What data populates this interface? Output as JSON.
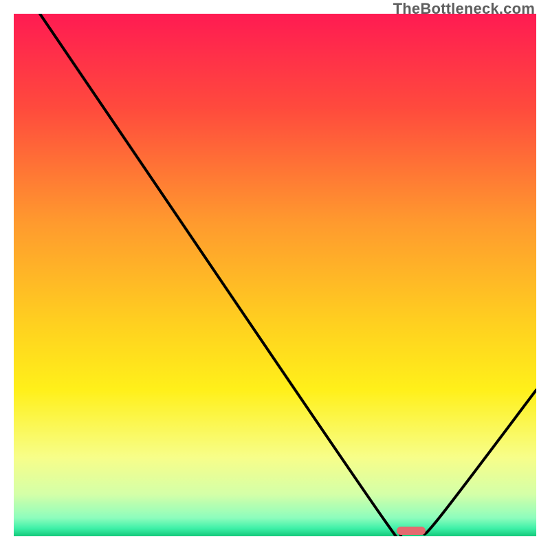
{
  "watermark": "TheBottleneck.com",
  "chart_data": {
    "type": "line",
    "title": "",
    "xlabel": "",
    "ylabel": "",
    "xlim": [
      0,
      100
    ],
    "ylim": [
      0,
      100
    ],
    "grid": false,
    "background_gradient_stops": [
      {
        "offset": 0.0,
        "color": "#ff1b52"
      },
      {
        "offset": 0.18,
        "color": "#ff4a3d"
      },
      {
        "offset": 0.4,
        "color": "#ff9a2e"
      },
      {
        "offset": 0.6,
        "color": "#ffd21f"
      },
      {
        "offset": 0.72,
        "color": "#fff01a"
      },
      {
        "offset": 0.85,
        "color": "#f7fe8a"
      },
      {
        "offset": 0.92,
        "color": "#d4ffa8"
      },
      {
        "offset": 0.965,
        "color": "#8dfdbd"
      },
      {
        "offset": 0.985,
        "color": "#3ef0a8"
      },
      {
        "offset": 1.0,
        "color": "#13c97a"
      }
    ],
    "series": [
      {
        "name": "bottleneck-curve",
        "color": "#000000",
        "points": [
          {
            "x": 5.0,
            "y": 100.0
          },
          {
            "x": 24.0,
            "y": 72.0
          },
          {
            "x": 71.0,
            "y": 3.0
          },
          {
            "x": 74.0,
            "y": 1.0
          },
          {
            "x": 78.0,
            "y": 1.0
          },
          {
            "x": 81.0,
            "y": 3.0
          },
          {
            "x": 100.0,
            "y": 28.0
          }
        ]
      }
    ],
    "marker": {
      "name": "optimal-marker",
      "x": 76.0,
      "y": 1.0,
      "color": "#e46a6f"
    }
  }
}
